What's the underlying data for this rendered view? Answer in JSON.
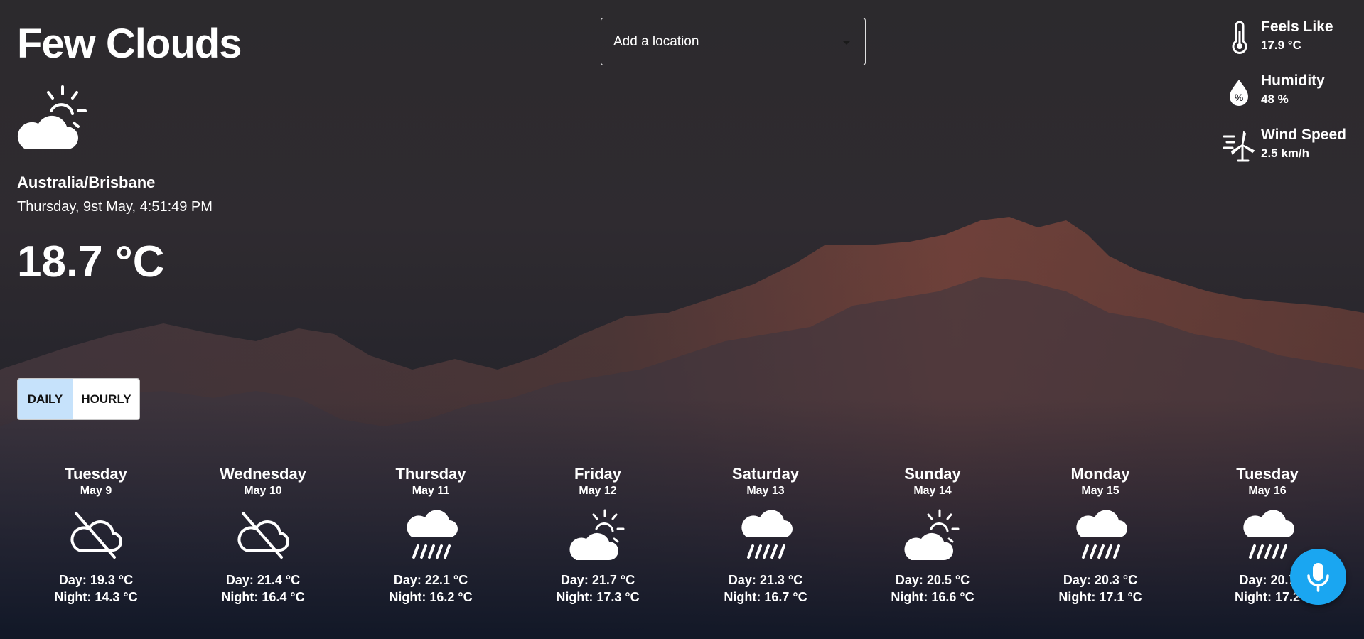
{
  "current": {
    "condition": "Few Clouds",
    "icon": "partly-cloudy-day-icon",
    "location": "Australia/Brisbane",
    "datetime": "Thursday, 9st May, 4:51:49 PM",
    "temperature": "18.7 °C"
  },
  "search": {
    "placeholder": "Add a location"
  },
  "stats": [
    {
      "label": "Feels Like",
      "value": "17.9 °C",
      "icon": "thermometer-icon"
    },
    {
      "label": "Humidity",
      "value": "48 %",
      "icon": "humidity-drop-icon"
    },
    {
      "label": "Wind Speed",
      "value": "2.5 km/h",
      "icon": "wind-turbine-icon"
    }
  ],
  "toggle": {
    "daily_label": "DAILY",
    "hourly_label": "HOURLY",
    "selected": "daily"
  },
  "forecast": [
    {
      "day": "Tuesday",
      "date": "May 9",
      "icon": "cloud-off-icon",
      "day_temp": "Day: 19.3 °C",
      "night_temp": "Night: 14.3 °C"
    },
    {
      "day": "Wednesday",
      "date": "May 10",
      "icon": "cloud-off-icon",
      "day_temp": "Day: 21.4 °C",
      "night_temp": "Night: 16.4 °C"
    },
    {
      "day": "Thursday",
      "date": "May 11",
      "icon": "rain-icon",
      "day_temp": "Day: 22.1 °C",
      "night_temp": "Night: 16.2 °C"
    },
    {
      "day": "Friday",
      "date": "May 12",
      "icon": "partly-cloudy-day-icon",
      "day_temp": "Day: 21.7 °C",
      "night_temp": "Night: 17.3 °C"
    },
    {
      "day": "Saturday",
      "date": "May 13",
      "icon": "rain-icon",
      "day_temp": "Day: 21.3 °C",
      "night_temp": "Night: 16.7 °C"
    },
    {
      "day": "Sunday",
      "date": "May 14",
      "icon": "partly-cloudy-day-icon",
      "day_temp": "Day: 20.5 °C",
      "night_temp": "Night: 16.6 °C"
    },
    {
      "day": "Monday",
      "date": "May 15",
      "icon": "rain-icon",
      "day_temp": "Day: 20.3 °C",
      "night_temp": "Night: 17.1 °C"
    },
    {
      "day": "Tuesday",
      "date": "May 16",
      "icon": "rain-icon",
      "day_temp": "Day: 20.7",
      "night_temp": "Night: 17.2"
    }
  ],
  "mic_button": {
    "icon": "microphone-icon"
  },
  "colors": {
    "accent": "#1aa6f1",
    "toggle_selected": "#c6e2fb",
    "mountain_glow": "#8a4a3e"
  }
}
